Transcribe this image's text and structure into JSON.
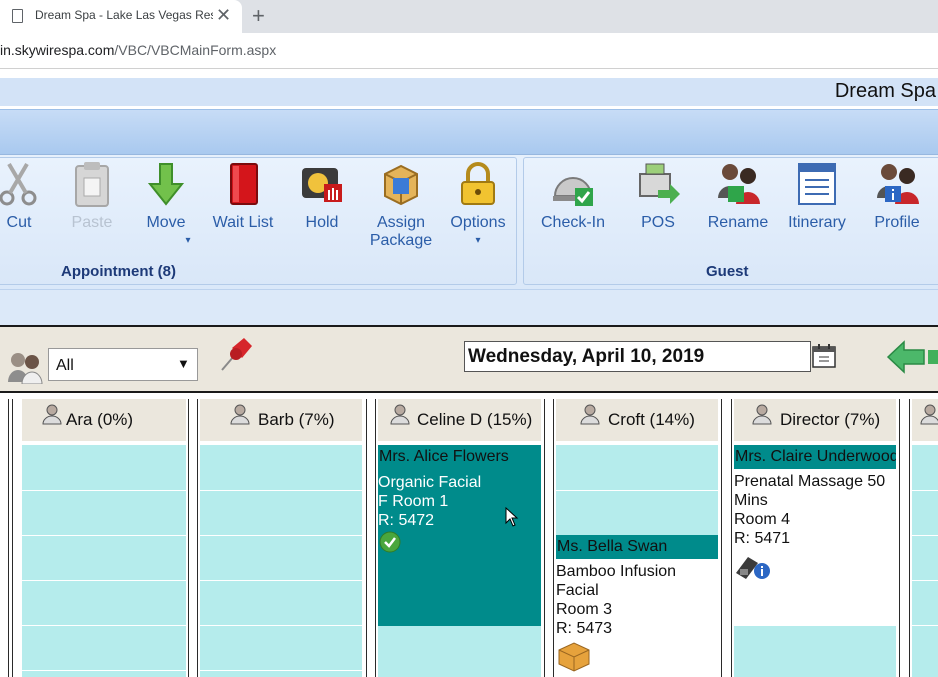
{
  "browser": {
    "tab_title": "Dream Spa - Lake Las Vegas Reso",
    "tab_close": "✕",
    "new_tab": "+",
    "url_prefix": "in.skywirespa.com",
    "url_path": "/VBC/VBCMainForm.aspx"
  },
  "app": {
    "title": "Dream Spa"
  },
  "ribbon": {
    "appointment_group": {
      "label": "Appointment (8)",
      "buttons": [
        {
          "label": "Cut",
          "icon": "scissors-icon"
        },
        {
          "label": "Paste",
          "icon": "clipboard-icon",
          "disabled": true
        },
        {
          "label": "Move",
          "icon": "down-arrow-icon",
          "has_dropdown": true
        },
        {
          "label": "Wait List",
          "icon": "red-book-icon"
        },
        {
          "label": "Hold",
          "icon": "hold-hand-icon"
        },
        {
          "label": "Assign",
          "label2": "Package",
          "icon": "package-box-icon"
        },
        {
          "label": "Options",
          "icon": "padlock-icon",
          "has_dropdown": true
        }
      ]
    },
    "guest_group": {
      "label": "Guest",
      "buttons": [
        {
          "label": "Check-In",
          "icon": "bell-check-icon"
        },
        {
          "label": "POS",
          "icon": "register-arrow-icon"
        },
        {
          "label": "Rename",
          "icon": "rename-people-icon"
        },
        {
          "label": "Itinerary",
          "icon": "itinerary-list-icon"
        },
        {
          "label": "Profile",
          "icon": "profile-people-icon"
        }
      ]
    },
    "dropdown_caret": "▾"
  },
  "toolbar": {
    "filter_value": "All",
    "filter_arrow": "▼",
    "date": "Wednesday, April 10, 2019"
  },
  "columns": [
    {
      "label": "Ara (0%)"
    },
    {
      "label": "Barb (7%)"
    },
    {
      "label": "Celine D (15%)"
    },
    {
      "label": "Croft (14%)"
    },
    {
      "label": "Director (7%)"
    }
  ],
  "appointments": [
    {
      "guest": "Mrs. Alice Flowers",
      "lines": [
        "Organic Facial",
        "F Room 1",
        "R: 5472"
      ],
      "status_icon": "checkmark-icon",
      "colors": {
        "bg": "#008b8b",
        "header": "#008b8b",
        "text": "#ffffff",
        "header_text": "#111111"
      }
    },
    {
      "guest": "Ms. Bella Swan",
      "lines": [
        "Bamboo Infusion",
        "Facial",
        "Room 3",
        "R: 5473"
      ],
      "status_icon": "package-box-icon",
      "colors": {
        "bg": "#ffffff",
        "header": "#008b8b",
        "text": "#111111",
        "header_text": "#111111"
      }
    },
    {
      "guest": "Mrs. Claire Underwood",
      "lines": [
        "Prenatal Massage 50",
        "Mins",
        "Room 4",
        "R: 5471"
      ],
      "status_icon": "phone-info-icon",
      "colors": {
        "bg": "#ffffff",
        "header": "#008b8b",
        "text": "#111111",
        "header_text": "#111111"
      }
    }
  ],
  "colors": {
    "cell": "#b5ecec",
    "accent": "#2b5da8",
    "group_label": "#1d3a78"
  }
}
